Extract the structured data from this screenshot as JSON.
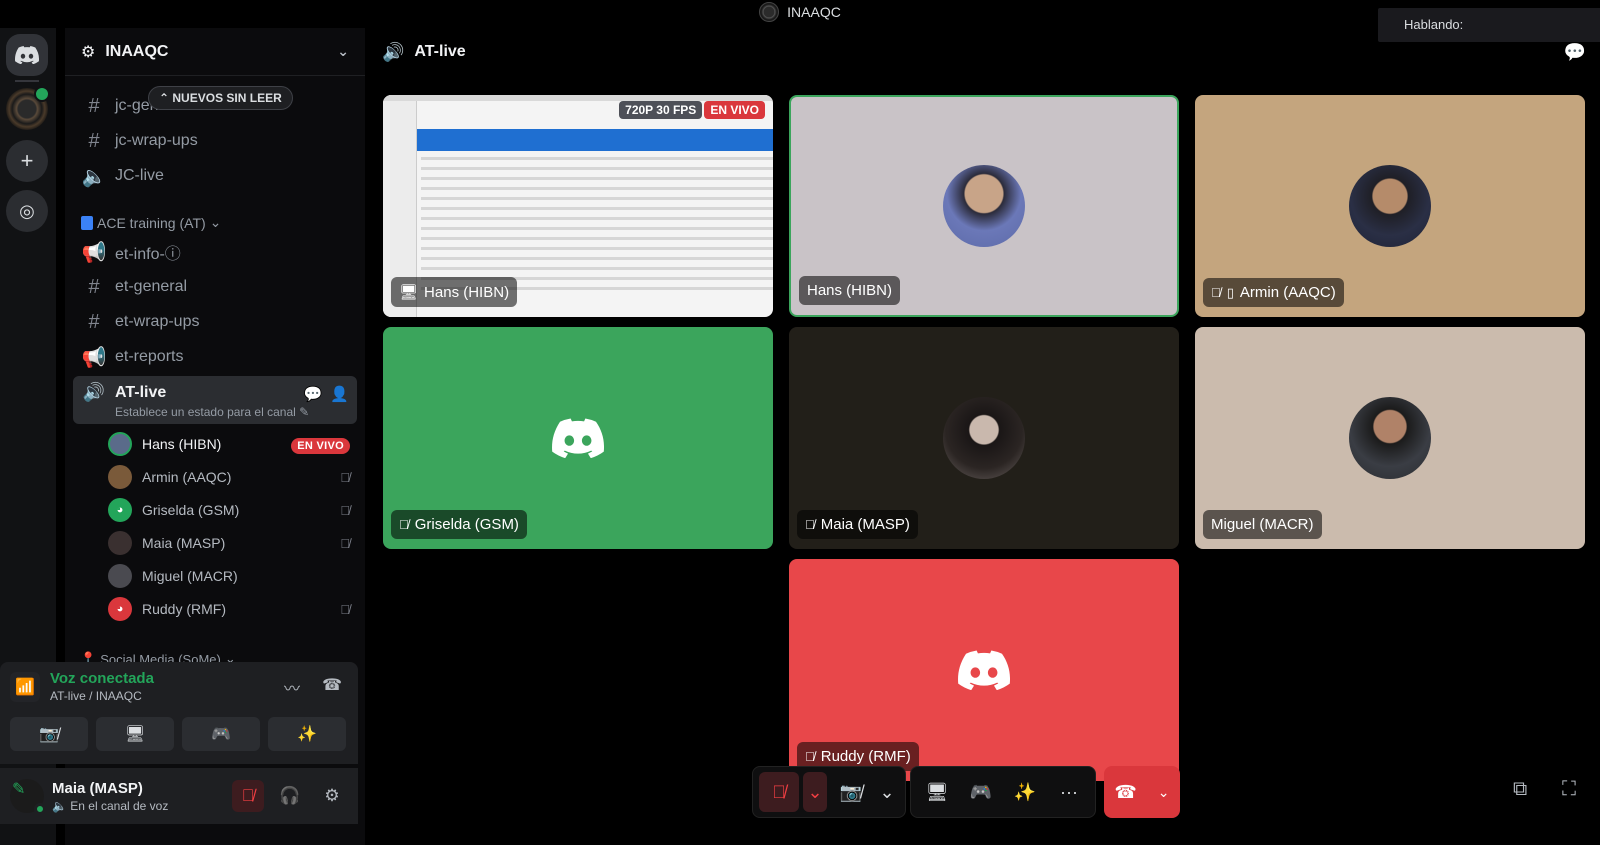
{
  "window": {
    "title": "INAAQC",
    "speaking_label": "Hablando:"
  },
  "server": {
    "name": "INAAQC"
  },
  "sidebar": {
    "unread_pill": "NUEVOS SIN LEER",
    "channels_top": [
      {
        "label": "jc-general-chat",
        "icon": "#"
      },
      {
        "label": "jc-wrap-ups",
        "icon": "#"
      },
      {
        "label": "JC-live",
        "icon": "speaker"
      }
    ],
    "category_ace": "ACE training (AT)",
    "channels_at": [
      {
        "label": "et-info-ⓘ",
        "icon": "megaphone"
      },
      {
        "label": "et-general",
        "icon": "#"
      },
      {
        "label": "et-wrap-ups",
        "icon": "#"
      },
      {
        "label": "et-reports",
        "icon": "megaphone"
      }
    ],
    "active_channel": {
      "label": "AT-live",
      "status": "Establece un estado para el canal"
    },
    "voice_users": [
      {
        "name": "Hans (HIBN)",
        "badge": "EN VIVO",
        "muted": false,
        "color": "#5a6b8a"
      },
      {
        "name": "Armin (AAQC)",
        "badge": "",
        "muted": true,
        "color": "#7a5a3a"
      },
      {
        "name": "Griselda (GSM)",
        "badge": "",
        "muted": true,
        "color": "#23a55a"
      },
      {
        "name": "Maia (MASP)",
        "badge": "",
        "muted": true,
        "color": "#3a3030"
      },
      {
        "name": "Miguel (MACR)",
        "badge": "",
        "muted": false,
        "color": "#4a4a50"
      },
      {
        "name": "Ruddy (RMF)",
        "badge": "",
        "muted": true,
        "color": "#da373c"
      }
    ],
    "category_social": "Social Media (SoMe)"
  },
  "voice_panel": {
    "title": "Voz conectada",
    "subtitle": "AT-live / INAAQC"
  },
  "user_panel": {
    "name": "Maia (MASP)",
    "status": "En el canal de voz"
  },
  "main": {
    "channel_title": "AT-live",
    "screen_badge_quality": "720P 30 FPS",
    "screen_badge_live": "EN VIVO",
    "tiles": [
      {
        "label": "Hans (HIBN)"
      },
      {
        "label": "Hans (HIBN)"
      },
      {
        "label": "Armin (AAQC)"
      },
      {
        "label": "Griselda (GSM)"
      },
      {
        "label": "Maia (MASP)"
      },
      {
        "label": "Miguel (MACR)"
      },
      {
        "label": "Ruddy (RMF)"
      }
    ]
  },
  "colors": {
    "green": "#23a55a",
    "red": "#da373c",
    "green_tile": "#3ba55c",
    "red_tile": "#e8474a"
  }
}
